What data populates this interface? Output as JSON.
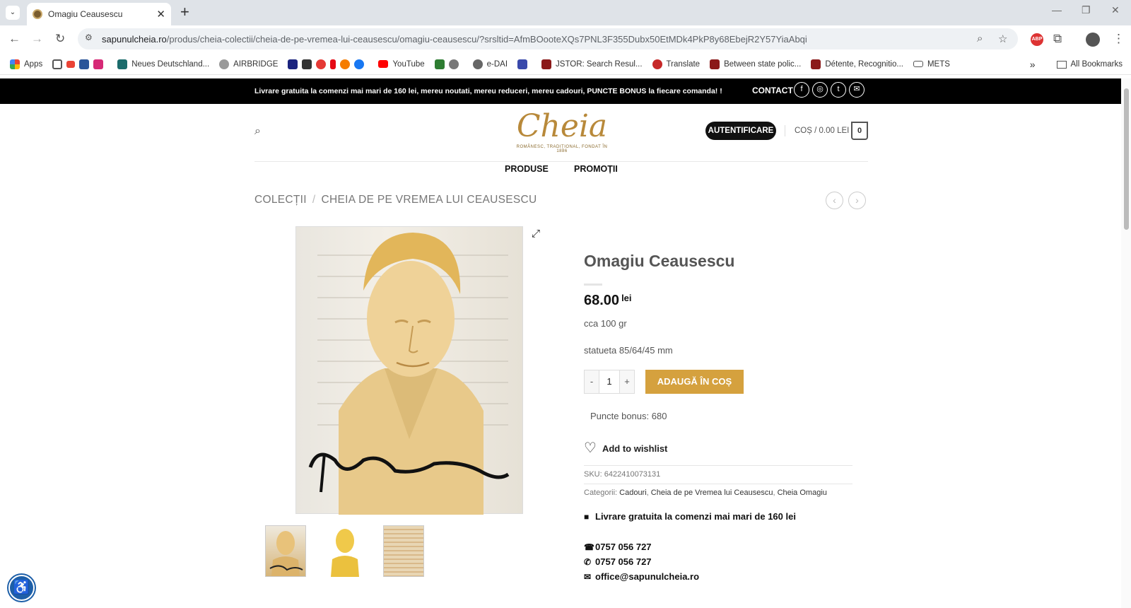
{
  "browser": {
    "tab_title": "Omagiu Ceausescu",
    "url_host": "sapunulcheia.ro",
    "url_path": "/produs/cheia-colectii/cheia-de-pe-vremea-lui-ceausescu/omagiu-ceausescu/?srsltid=AfmBOooteXQs7PNL3F355Dubx50EtMDk4PkP8y68EbejR2Y57YiaAbqi",
    "bookmarks": [
      "Apps",
      "Neues Deutschland...",
      "AIRBRIDGE",
      "YouTube",
      "e-DAI",
      "JSTOR: Search Resul...",
      "Translate",
      "Between state polic...",
      "Détente, Recognitio...",
      "METS"
    ],
    "all_bookmarks": "All Bookmarks"
  },
  "site": {
    "promo": "Livrare gratuita la comenzi mai mari de 160 lei, mereu noutati, mereu reduceri, mereu cadouri, PUNCTE BONUS la fiecare comanda! !",
    "contact": "CONTACT",
    "logo": "Cheia",
    "logo_tagline": "ROMÂNESC, TRADIȚIONAL, FONDAT ÎN 1886",
    "auth": "AUTENTIFICARE",
    "cart": "COȘ / 0.00 LEI",
    "cart_count": "0",
    "nav": [
      "PRODUSE",
      "PROMOȚII"
    ],
    "breadcrumb": [
      "COLECȚII",
      "CHEIA DE PE VREMEA LUI CEAUSESCU"
    ]
  },
  "product": {
    "title": "Omagiu Ceausescu",
    "price": "68.00",
    "currency": "lei",
    "weight": "cca 100 gr",
    "size": "statueta 85/64/45 mm",
    "qty": "1",
    "minus": "-",
    "plus": "+",
    "add_to_cart": "ADAUGĂ ÎN COȘ",
    "bonus": "Puncte bonus: 680",
    "wishlist": "Add to wishlist",
    "sku_label": "SKU:",
    "sku": "6422410073131",
    "categories_label": "Categorii:",
    "categories": [
      "Cadouri",
      "Cheia de pe Vremea lui Ceausescu",
      "Cheia Omagiu"
    ],
    "delivery": "Livrare gratuita la comenzi mai mari de 160 lei",
    "phone": "0757 056 727",
    "whatsapp": "0757 056 727",
    "email": "office@sapunulcheia.ro"
  },
  "colors": {
    "accent": "#d5a13e",
    "brand": "#b8893a",
    "topbar": "#000000"
  }
}
